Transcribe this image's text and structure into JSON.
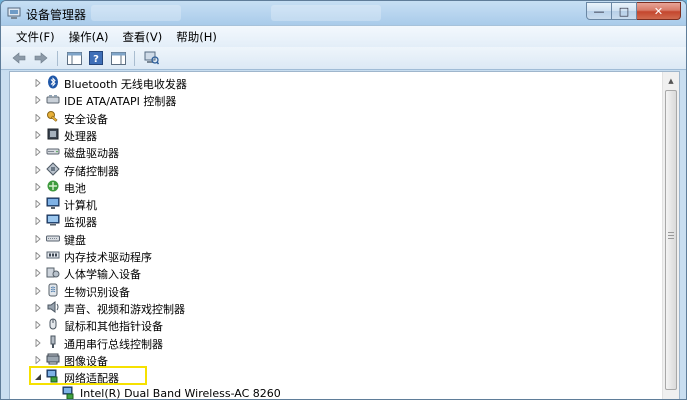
{
  "window": {
    "title": "设备管理器",
    "caption_buttons": {
      "minimize": "—",
      "maximize": "□",
      "close": "✕"
    }
  },
  "menubar": {
    "items": [
      "文件(F)",
      "操作(A)",
      "查看(V)",
      "帮助(H)"
    ]
  },
  "toolbar": {
    "buttons": [
      {
        "icon": "back-arrow-icon"
      },
      {
        "icon": "forward-arrow-icon"
      },
      {
        "icon": "properties-icon"
      },
      {
        "icon": "help-icon"
      },
      {
        "icon": "console-tree-icon"
      },
      {
        "icon": "scan-hardware-icon"
      }
    ]
  },
  "tree": {
    "nodes": [
      {
        "label": "Bluetooth 无线电收发器",
        "icon": "bluetooth-icon",
        "expanded": false
      },
      {
        "label": "IDE ATA/ATAPI 控制器",
        "icon": "ide-controller-icon",
        "expanded": false
      },
      {
        "label": "安全设备",
        "icon": "security-key-icon",
        "expanded": false
      },
      {
        "label": "处理器",
        "icon": "processor-icon",
        "expanded": false
      },
      {
        "label": "磁盘驱动器",
        "icon": "disk-drive-icon",
        "expanded": false
      },
      {
        "label": "存储控制器",
        "icon": "storage-controller-icon",
        "expanded": false
      },
      {
        "label": "电池",
        "icon": "battery-icon",
        "expanded": false
      },
      {
        "label": "计算机",
        "icon": "computer-icon",
        "expanded": false
      },
      {
        "label": "监视器",
        "icon": "monitor-icon",
        "expanded": false
      },
      {
        "label": "键盘",
        "icon": "keyboard-icon",
        "expanded": false
      },
      {
        "label": "内存技术驱动程序",
        "icon": "memory-driver-icon",
        "expanded": false
      },
      {
        "label": "人体学输入设备",
        "icon": "hid-icon",
        "expanded": false
      },
      {
        "label": "生物识别设备",
        "icon": "biometric-icon",
        "expanded": false
      },
      {
        "label": "声音、视频和游戏控制器",
        "icon": "sound-icon",
        "expanded": false
      },
      {
        "label": "鼠标和其他指针设备",
        "icon": "mouse-icon",
        "expanded": false
      },
      {
        "label": "通用串行总线控制器",
        "icon": "usb-icon",
        "expanded": false
      },
      {
        "label": "图像设备",
        "icon": "imaging-device-icon",
        "expanded": false
      },
      {
        "label": "网络适配器",
        "icon": "network-adapter-icon",
        "expanded": true,
        "highlighted": true
      },
      {
        "label": "Intel(R) Dual Band Wireless-AC 8260",
        "icon": "network-adapter-icon",
        "child": true
      }
    ]
  },
  "colors": {
    "highlight_border": "#f6e100",
    "title_bar": "#b8d5ef",
    "close_button": "#c4462e"
  }
}
